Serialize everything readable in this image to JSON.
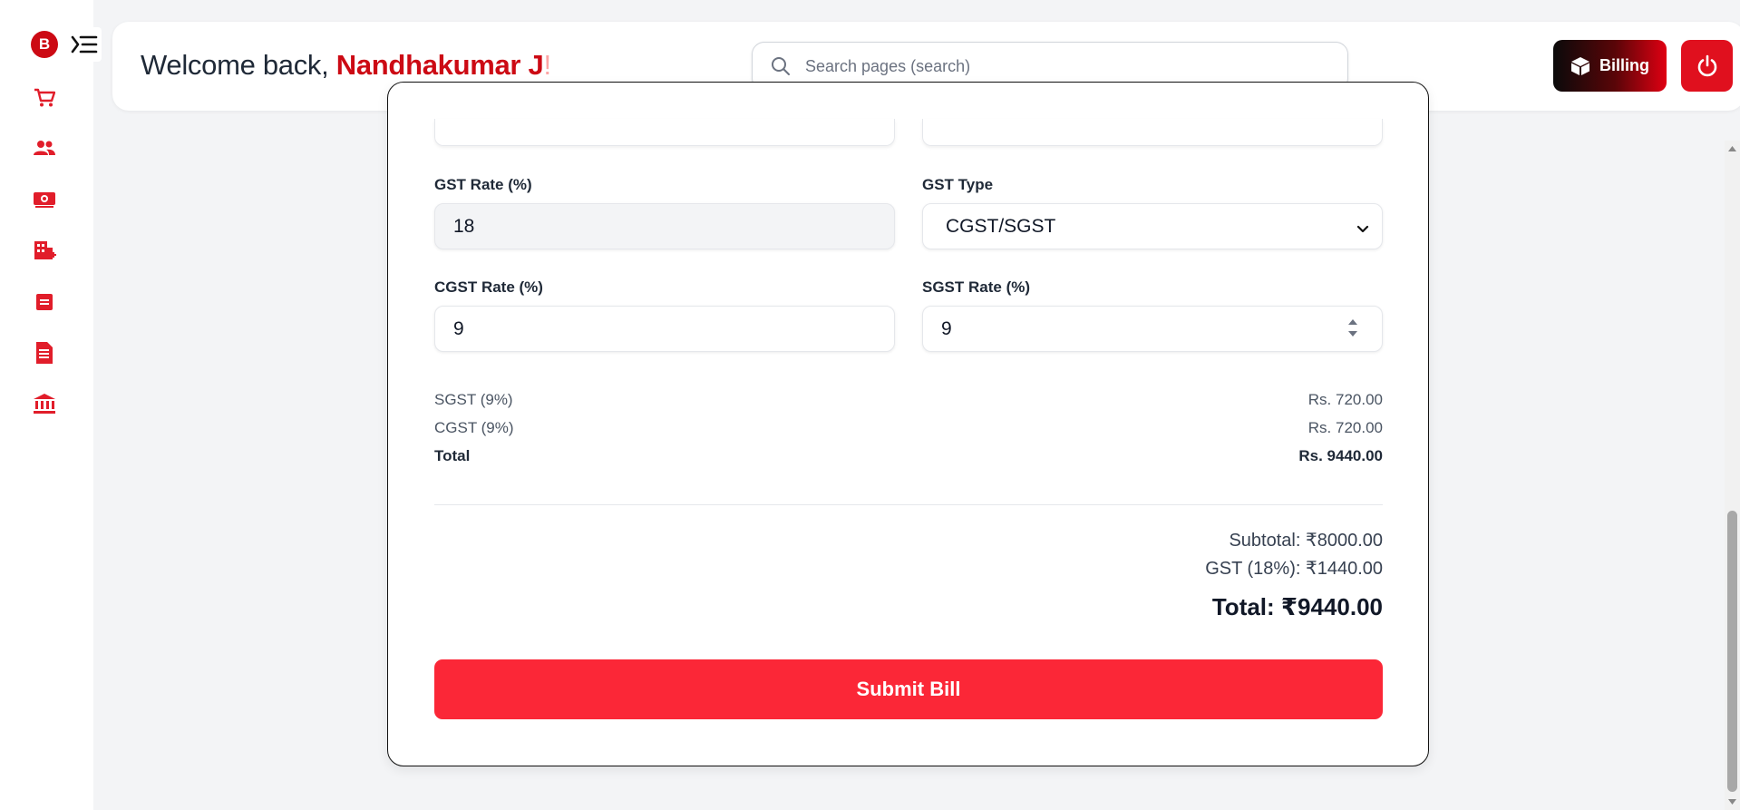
{
  "sidebar": {
    "logo_letter": "B",
    "items": [
      {
        "name": "cart",
        "icon": "shopping-cart-icon"
      },
      {
        "name": "customers",
        "icon": "users-icon"
      },
      {
        "name": "payments",
        "icon": "money-icon"
      },
      {
        "name": "company",
        "icon": "building-add-icon"
      },
      {
        "name": "reports",
        "icon": "note-icon"
      },
      {
        "name": "documents",
        "icon": "document-icon"
      },
      {
        "name": "bank",
        "icon": "bank-icon"
      }
    ]
  },
  "header": {
    "welcome_prefix": "Welcome back, ",
    "user_name": "Nandhakumar J",
    "welcome_suffix": "!",
    "search_placeholder": "Search pages (search)",
    "billing_label": "Billing"
  },
  "form": {
    "gst_rate_label": "GST Rate (%)",
    "gst_rate_value": "18",
    "gst_type_label": "GST Type",
    "gst_type_value": "CGST/SGST",
    "cgst_rate_label": "CGST Rate (%)",
    "cgst_rate_value": "9",
    "sgst_rate_label": "SGST Rate (%)",
    "sgst_rate_value": "9"
  },
  "tax_summary": {
    "sgst_label": "SGST (9%)",
    "sgst_value": "Rs. 720.00",
    "cgst_label": "CGST (9%)",
    "cgst_value": "Rs. 720.00",
    "total_label": "Total",
    "total_value": "Rs. 9440.00"
  },
  "totals": {
    "subtotal": "Subtotal: ₹8000.00",
    "gst": "GST (18%): ₹1440.00",
    "total": "Total: ₹9440.00"
  },
  "submit_label": "Submit Bill",
  "colors": {
    "brand_red": "#cc0a14",
    "submit_red": "#fb2737",
    "icon_red": "#e11d2a"
  }
}
